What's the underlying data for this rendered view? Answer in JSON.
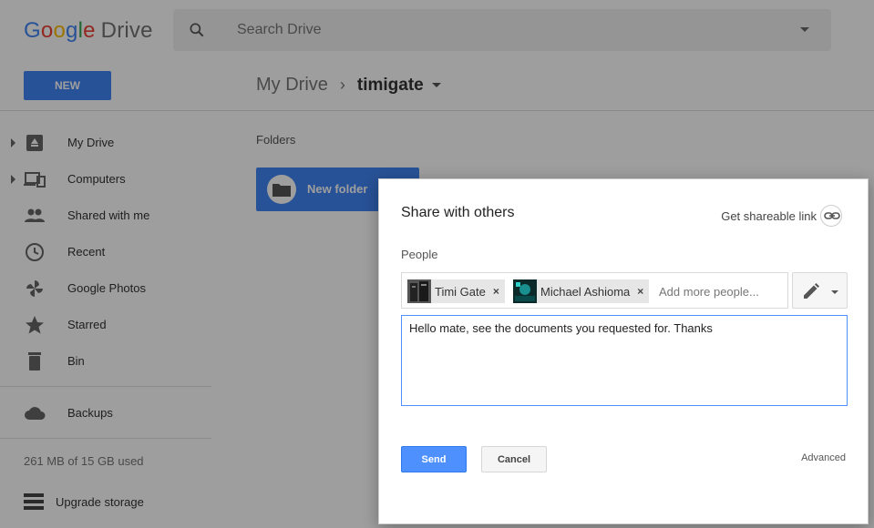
{
  "app": {
    "logo_parts": [
      "G",
      "o",
      "o",
      "g",
      "l",
      "e"
    ],
    "logo_product": "Drive"
  },
  "search": {
    "placeholder": "Search Drive"
  },
  "toolbar": {
    "new_label": "NEW"
  },
  "breadcrumb": {
    "root": "My Drive",
    "separator": "›",
    "current": "timigate"
  },
  "sidebar": {
    "items": [
      {
        "label": "My Drive",
        "icon": "drive-icon"
      },
      {
        "label": "Computers",
        "icon": "computers-icon"
      },
      {
        "label": "Shared with me",
        "icon": "people-icon"
      },
      {
        "label": "Recent",
        "icon": "clock-icon"
      },
      {
        "label": "Google Photos",
        "icon": "photos-icon"
      },
      {
        "label": "Starred",
        "icon": "star-icon"
      },
      {
        "label": "Bin",
        "icon": "trash-icon"
      },
      {
        "label": "Backups",
        "icon": "cloud-icon"
      }
    ],
    "quota": "261 MB of 15 GB used",
    "upgrade_label": "Upgrade storage"
  },
  "main": {
    "section_label": "Folders",
    "folders": [
      {
        "name": "New folder"
      }
    ]
  },
  "dialog": {
    "title": "Share with others",
    "link_label": "Get shareable link",
    "people_label": "People",
    "recipients": [
      {
        "name": "Timi Gate"
      },
      {
        "name": "Michael Ashioma"
      }
    ],
    "remove_glyph": "×",
    "add_placeholder": "Add more people...",
    "message": "Hello mate, see the documents you requested for. Thanks",
    "send_label": "Send",
    "cancel_label": "Cancel",
    "advanced_label": "Advanced"
  },
  "colors": {
    "accent": "#4285f4",
    "send_button": "#4d90fe",
    "overlay": "rgba(0,0,0,0.38)"
  }
}
